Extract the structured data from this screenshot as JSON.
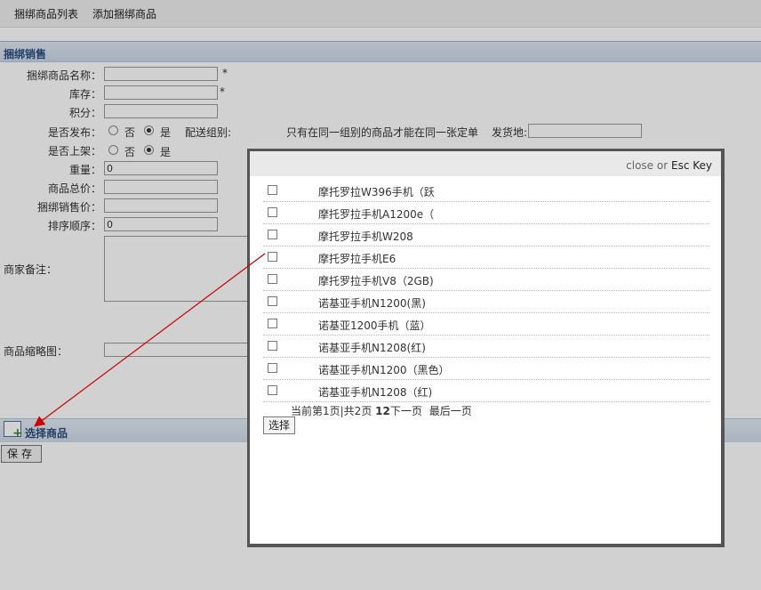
{
  "top_tabs": {
    "list": "捆绑商品列表",
    "add": "添加捆绑商品"
  },
  "section_title": "捆绑销售",
  "form": {
    "name_label": "捆绑商品名称：",
    "stock_label": "库存：",
    "points_label": "积分：",
    "publish_label": "是否发布：",
    "publish_no": "否",
    "publish_yes": "是",
    "shipping_group_label": "配送组别:",
    "shipping_note": "只有在同一组别的商品才能在同一张定单",
    "ship_from_label": "发货地:",
    "onshelf_label": "是否上架：",
    "onshelf_no": "否",
    "onshelf_yes": "是",
    "weight_label": "重量：",
    "weight_value": "0",
    "total_price_label": "商品总价：",
    "bundle_price_label": "捆绑销售价：",
    "sort_label": "排序顺序：",
    "sort_value": "0",
    "remark_label": "商家备注：",
    "thumb_label": "商品缩略图：",
    "required_mark": "*"
  },
  "select_products_label": "选择商品",
  "save_label": "保存",
  "modal": {
    "close": "close",
    "or": " or ",
    "esc": "Esc Key",
    "items": [
      "摩托罗拉W396手机（跃",
      "摩托罗拉手机A1200e（",
      "摩托罗拉手机W208",
      "摩托罗拉手机E6",
      "摩托罗拉手机V8（2GB)",
      "诺基亚手机N1200(黑)",
      "诺基亚1200手机（蓝）",
      "诺基亚手机N1208(红)",
      "诺基亚手机N1200（黑色）",
      "诺基亚手机N1208（红)"
    ],
    "pager": {
      "current": "当前第1页|共2页",
      "pages": "12",
      "next": "下一页",
      "last": "最后一页"
    },
    "choose_label": "选择"
  },
  "colors": {
    "section_blue": "#2b4d7e",
    "arrow_red": "#d00000"
  }
}
